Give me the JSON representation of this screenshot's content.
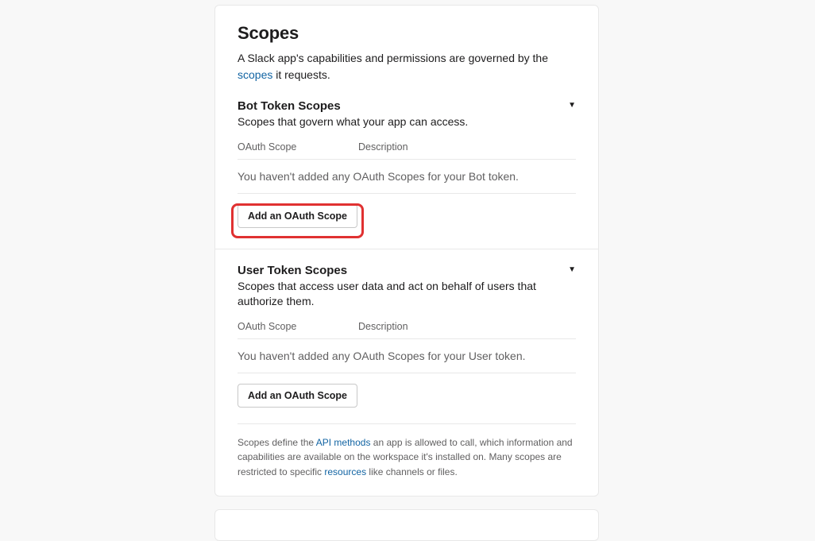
{
  "header": {
    "title": "Scopes",
    "desc_before": "A Slack app's capabilities and permissions are governed by the ",
    "desc_link": "scopes",
    "desc_after": " it requests."
  },
  "bot": {
    "title": "Bot Token Scopes",
    "subtitle": "Scopes that govern what your app can access.",
    "col_scope": "OAuth Scope",
    "col_desc": "Description",
    "empty": "You haven't added any OAuth Scopes for your Bot token.",
    "add_btn": "Add an OAuth Scope"
  },
  "user": {
    "title": "User Token Scopes",
    "subtitle": "Scopes that access user data and act on behalf of users that authorize them.",
    "col_scope": "OAuth Scope",
    "col_desc": "Description",
    "empty": "You haven't added any OAuth Scopes for your User token.",
    "add_btn": "Add an OAuth Scope"
  },
  "footnote": {
    "t1": "Scopes define the ",
    "link1": "API methods",
    "t2": " an app is allowed to call, which information and capabilities are available on the workspace it's installed on. Many scopes are restricted to specific ",
    "link2": "resources",
    "t3": " like channels or files."
  },
  "highlight": {
    "target": "add-bot-oauth-scope-button"
  }
}
